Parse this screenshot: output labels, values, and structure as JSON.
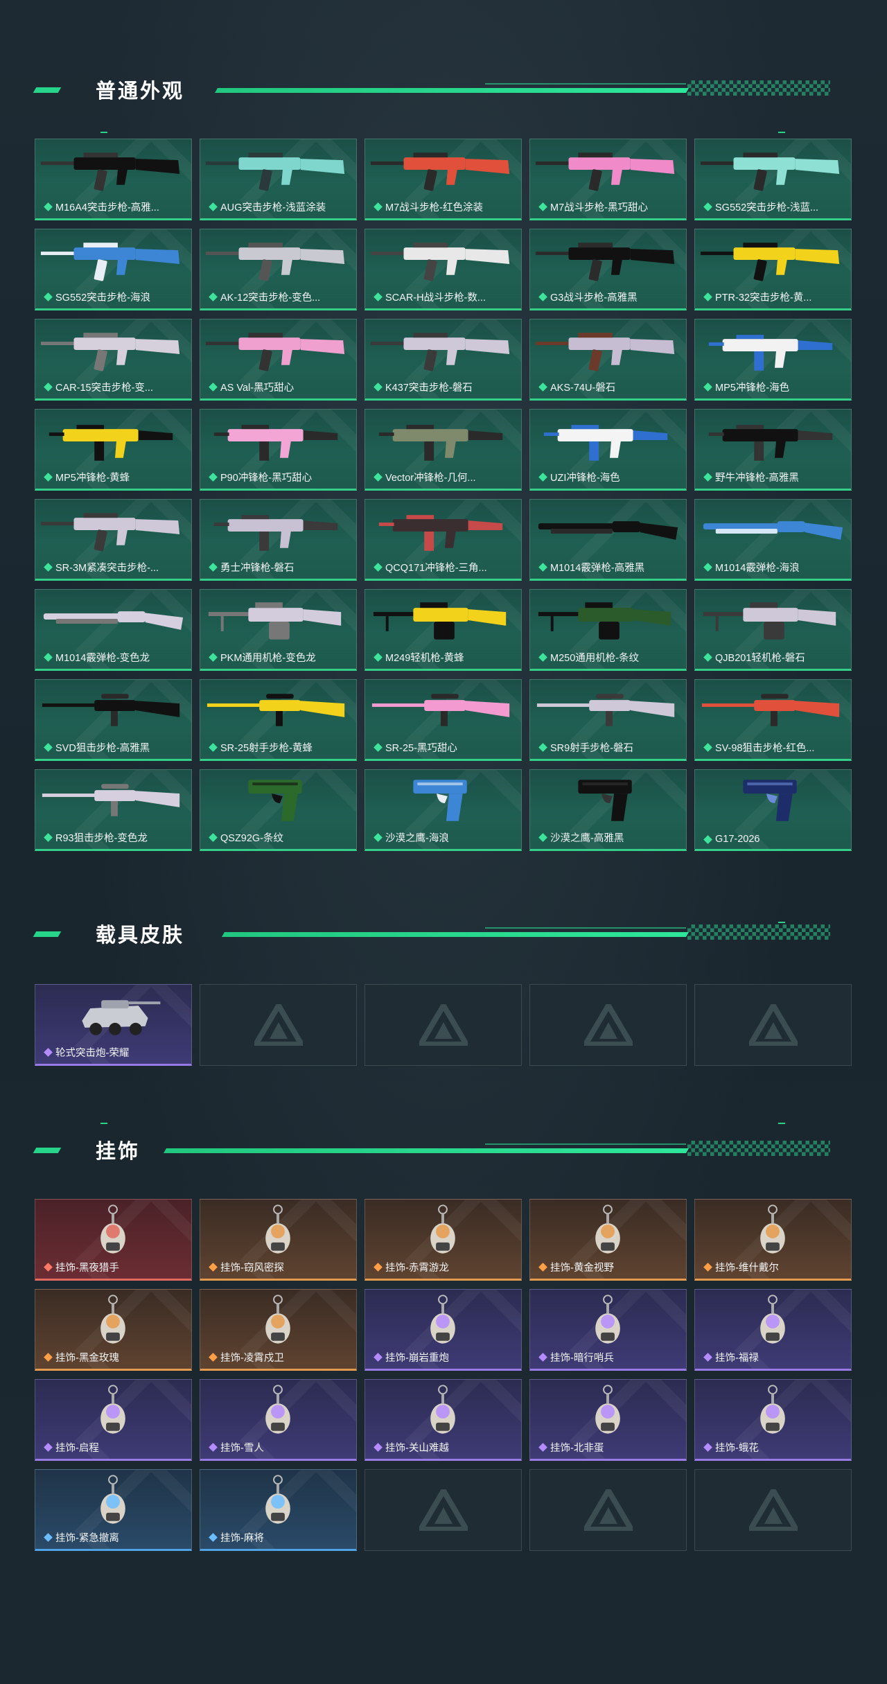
{
  "colors": {
    "accent": "#27d58a",
    "background": "#1b2830",
    "rarity_green": "#34d08a",
    "rarity_purple": "#9a7be6",
    "rarity_red": "#e26a5e",
    "rarity_orange": "#e59b4e",
    "rarity_blue": "#4ea3e6"
  },
  "sections": {
    "weapons": {
      "title": "普通外观",
      "items": [
        {
          "label": "M16A4突击步枪-高雅...",
          "rarity": "green",
          "icon": "rifle-icon",
          "c1": "#111111",
          "c2": "#333333"
        },
        {
          "label": "AUG突击步枪-浅蓝涂装",
          "rarity": "green",
          "icon": "rifle-icon",
          "c1": "#7fd6cc",
          "c2": "#2a3a3a"
        },
        {
          "label": "M7战斗步枪-红色涂装",
          "rarity": "green",
          "icon": "rifle-icon",
          "c1": "#e0503a",
          "c2": "#2a2a2a"
        },
        {
          "label": "M7战斗步枪-黑巧甜心",
          "rarity": "green",
          "icon": "rifle-icon",
          "c1": "#f08ac8",
          "c2": "#2a2a2a"
        },
        {
          "label": "SG552突击步枪-浅蓝...",
          "rarity": "green",
          "icon": "rifle-icon",
          "c1": "#8fe0d4",
          "c2": "#2a2a2a"
        },
        {
          "label": "SG552突击步枪-海浪",
          "rarity": "green",
          "icon": "rifle-icon",
          "c1": "#3d86d6",
          "c2": "#e8eef5"
        },
        {
          "label": "AK-12突击步枪-变色...",
          "rarity": "green",
          "icon": "rifle-icon",
          "c1": "#c9c9d2",
          "c2": "#555555"
        },
        {
          "label": "SCAR-H战斗步枪-数...",
          "rarity": "green",
          "icon": "rifle-icon",
          "c1": "#e8e8e8",
          "c2": "#444444"
        },
        {
          "label": "G3战斗步枪-高雅黑",
          "rarity": "green",
          "icon": "rifle-icon",
          "c1": "#111111",
          "c2": "#2b2b2b"
        },
        {
          "label": "PTR-32突击步枪-黄...",
          "rarity": "green",
          "icon": "rifle-icon",
          "c1": "#f2d21a",
          "c2": "#111111"
        },
        {
          "label": "CAR-15突击步枪-变...",
          "rarity": "green",
          "icon": "rifle-icon",
          "c1": "#d6d0dc",
          "c2": "#777777"
        },
        {
          "label": "AS Val-黑巧甜心",
          "rarity": "green",
          "icon": "rifle-icon",
          "c1": "#f0a0cf",
          "c2": "#333333"
        },
        {
          "label": "K437突击步枪-磐石",
          "rarity": "green",
          "icon": "rifle-icon",
          "c1": "#cfc8d8",
          "c2": "#3a3a3a"
        },
        {
          "label": "AKS-74U-磐石",
          "rarity": "green",
          "icon": "rifle-icon",
          "c1": "#c7bdd3",
          "c2": "#6b3a2a"
        },
        {
          "label": "MP5冲锋枪-海色",
          "rarity": "green",
          "icon": "smg-icon",
          "c1": "#f2f2f2",
          "c2": "#2f6fd0"
        },
        {
          "label": "MP5冲锋枪-黄蜂",
          "rarity": "green",
          "icon": "smg-icon",
          "c1": "#f2d21a",
          "c2": "#111111"
        },
        {
          "label": "P90冲锋枪-黑巧甜心",
          "rarity": "green",
          "icon": "smg-icon",
          "c1": "#f3a6d6",
          "c2": "#2a2a2a"
        },
        {
          "label": "Vector冲锋枪-几何...",
          "rarity": "green",
          "icon": "smg-icon",
          "c1": "#7f8a6c",
          "c2": "#2a2a2a"
        },
        {
          "label": "UZI冲锋枪-海色",
          "rarity": "green",
          "icon": "smg-icon",
          "c1": "#f4f4f4",
          "c2": "#2f6fd0"
        },
        {
          "label": "野牛冲锋枪-高雅黑",
          "rarity": "green",
          "icon": "smg-icon",
          "c1": "#111111",
          "c2": "#333333"
        },
        {
          "label": "SR-3M紧凑突击步枪-...",
          "rarity": "green",
          "icon": "rifle-icon",
          "c1": "#cfc8d8",
          "c2": "#3a3a3a"
        },
        {
          "label": "勇士冲锋枪-磐石",
          "rarity": "green",
          "icon": "smg-icon",
          "c1": "#c8c1d4",
          "c2": "#3a3a3a"
        },
        {
          "label": "QCQ171冲锋枪-三角...",
          "rarity": "green",
          "icon": "smg-icon",
          "c1": "#3a2e30",
          "c2": "#c74a4a"
        },
        {
          "label": "M1014霰弹枪-高雅黑",
          "rarity": "green",
          "icon": "shotgun-icon",
          "c1": "#111111",
          "c2": "#2a2a2a"
        },
        {
          "label": "M1014霰弹枪-海浪",
          "rarity": "green",
          "icon": "shotgun-icon",
          "c1": "#3d86d6",
          "c2": "#d6e6f5"
        },
        {
          "label": "M1014霰弹枪-变色龙",
          "rarity": "green",
          "icon": "shotgun-icon",
          "c1": "#d6cfe0",
          "c2": "#777777"
        },
        {
          "label": "PKM通用机枪-变色龙",
          "rarity": "green",
          "icon": "lmg-icon",
          "c1": "#d2ccdc",
          "c2": "#777777"
        },
        {
          "label": "M249轻机枪-黄蜂",
          "rarity": "green",
          "icon": "lmg-icon",
          "c1": "#f2d21a",
          "c2": "#111111"
        },
        {
          "label": "M250通用机枪-条纹",
          "rarity": "green",
          "icon": "lmg-icon",
          "c1": "#2b5a2b",
          "c2": "#111111"
        },
        {
          "label": "QJB201轻机枪-磐石",
          "rarity": "green",
          "icon": "lmg-icon",
          "c1": "#cfc8d8",
          "c2": "#3a3a3a"
        },
        {
          "label": "SVD狙击步枪-高雅黑",
          "rarity": "green",
          "icon": "sniper-icon",
          "c1": "#111111",
          "c2": "#2a2a2a"
        },
        {
          "label": "SR-25射手步枪-黄蜂",
          "rarity": "green",
          "icon": "sniper-icon",
          "c1": "#f2d21a",
          "c2": "#111111"
        },
        {
          "label": "SR-25-黑巧甜心",
          "rarity": "green",
          "icon": "sniper-icon",
          "c1": "#f39ad0",
          "c2": "#2a2a2a"
        },
        {
          "label": "SR9射手步枪-磐石",
          "rarity": "green",
          "icon": "sniper-icon",
          "c1": "#cfc8d8",
          "c2": "#3a3a3a"
        },
        {
          "label": "SV-98狙击步枪-红色...",
          "rarity": "green",
          "icon": "sniper-icon",
          "c1": "#e0503a",
          "c2": "#2a2a2a"
        },
        {
          "label": "R93狙击步枪-变色龙",
          "rarity": "green",
          "icon": "sniper-icon",
          "c1": "#d6cfe0",
          "c2": "#777777"
        },
        {
          "label": "QSZ92G-条纹",
          "rarity": "green",
          "icon": "pistol-icon",
          "c1": "#2b6a2b",
          "c2": "#111111"
        },
        {
          "label": "沙漠之鹰-海浪",
          "rarity": "green",
          "icon": "pistol-icon",
          "c1": "#3d86d6",
          "c2": "#e8eef5"
        },
        {
          "label": "沙漠之鹰-高雅黑",
          "rarity": "green",
          "icon": "pistol-icon",
          "c1": "#111111",
          "c2": "#333333"
        },
        {
          "label": "G17-2026",
          "rarity": "green",
          "icon": "pistol-icon",
          "c1": "#1d2d6a",
          "c2": "#6b8bd6"
        }
      ]
    },
    "vehicles": {
      "title": "载具皮肤",
      "items": [
        {
          "label": "轮式突击炮-荣耀",
          "rarity": "purple",
          "icon": "vehicle-icon"
        }
      ],
      "empty_slots": 4
    },
    "charms": {
      "title": "挂饰",
      "items": [
        {
          "label": "挂饰-黑夜猎手",
          "rarity": "red",
          "icon": "charm-icon"
        },
        {
          "label": "挂饰-窃风密探",
          "rarity": "orange",
          "icon": "charm-icon"
        },
        {
          "label": "挂饰-赤霄游龙",
          "rarity": "orange",
          "icon": "charm-icon"
        },
        {
          "label": "挂饰-黄金视野",
          "rarity": "orange",
          "icon": "charm-icon"
        },
        {
          "label": "挂饰-维什戴尔",
          "rarity": "orange",
          "icon": "charm-icon"
        },
        {
          "label": "挂饰-黑金玫瑰",
          "rarity": "orange",
          "icon": "charm-icon"
        },
        {
          "label": "挂饰-凌霄戍卫",
          "rarity": "orange",
          "icon": "charm-icon"
        },
        {
          "label": "挂饰-崩岩重炮",
          "rarity": "purple",
          "icon": "charm-icon"
        },
        {
          "label": "挂饰-暗行哨兵",
          "rarity": "purple",
          "icon": "charm-icon"
        },
        {
          "label": "挂饰-福禄",
          "rarity": "purple",
          "icon": "charm-icon"
        },
        {
          "label": "挂饰-启程",
          "rarity": "purple",
          "icon": "charm-icon"
        },
        {
          "label": "挂饰-雪人",
          "rarity": "purple",
          "icon": "charm-icon"
        },
        {
          "label": "挂饰-关山难越",
          "rarity": "purple",
          "icon": "charm-icon"
        },
        {
          "label": "挂饰-北非蛋",
          "rarity": "purple",
          "icon": "charm-icon"
        },
        {
          "label": "挂饰-蛾花",
          "rarity": "purple",
          "icon": "charm-icon"
        },
        {
          "label": "挂饰-紧急撤离",
          "rarity": "blue",
          "icon": "charm-icon"
        },
        {
          "label": "挂饰-麻将",
          "rarity": "blue",
          "icon": "charm-icon"
        }
      ],
      "empty_slots": 3
    }
  }
}
